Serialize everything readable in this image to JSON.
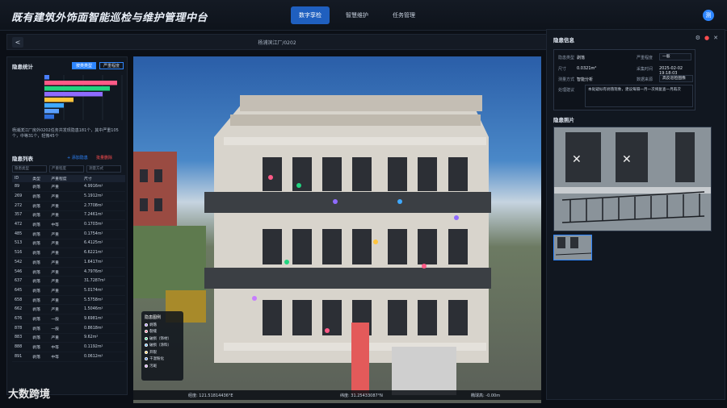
{
  "app": {
    "title": "既有建筑外饰面智能巡检与维护管理中台",
    "avatar": "测"
  },
  "nav": {
    "tabs": [
      {
        "label": "数字孪检",
        "active": true
      },
      {
        "label": "智慧维护",
        "active": false
      },
      {
        "label": "任务管理",
        "active": false
      }
    ]
  },
  "subbar": {
    "back": "<",
    "breadcrumb": "杨浦滨江厂/0202"
  },
  "stats": {
    "title": "隐患统计",
    "toggle_a": "按类类型",
    "toggle_b": "严重程度",
    "summary": "杨浦滨江厂房外0202任务共发现隐患181个，其中严重105个，中等31个，轻微45个"
  },
  "chart_data": {
    "type": "bar",
    "orientation": "horizontal",
    "categories": [
      "",
      "",
      "",
      "",
      "",
      "",
      "",
      ""
    ],
    "values": [
      2,
      30,
      27,
      24,
      12,
      8,
      6,
      4
    ],
    "colors": [
      "#4a7fff",
      "#ff5a87",
      "#21d47f",
      "#8f6bff",
      "#ffc53d",
      "#3fa9ff",
      "#5aa0ff",
      "#2e6edc"
    ],
    "xlim": [
      0,
      32
    ],
    "grid": true
  },
  "list": {
    "title": "隐患列表",
    "add": "+ 添加隐患",
    "delete": "批量删除",
    "filters": [
      "隐患类型",
      "严重程度",
      "测量方式"
    ],
    "headers": [
      "ID",
      "类型",
      "严重程度",
      "尺寸"
    ],
    "rows": [
      [
        "89",
        "剥落",
        "严重",
        "4.9916m²"
      ],
      [
        "269",
        "剥落",
        "严重",
        "5.1912m²"
      ],
      [
        "272",
        "剥落",
        "严重",
        "2.7708m²"
      ],
      [
        "357",
        "剥落",
        "严重",
        "7.2461m²"
      ],
      [
        "472",
        "剥落",
        "中等",
        "0.1703m²"
      ],
      [
        "485",
        "剥落",
        "严重",
        "0.1754m²"
      ],
      [
        "513",
        "剥落",
        "严重",
        "6.4125m²"
      ],
      [
        "516",
        "剥落",
        "严重",
        "6.6221m²"
      ],
      [
        "542",
        "剥落",
        "严重",
        "1.6417m²"
      ],
      [
        "546",
        "剥落",
        "严重",
        "4.7976m²"
      ],
      [
        "637",
        "剥落",
        "严重",
        "31.7287m²"
      ],
      [
        "645",
        "剥落",
        "严重",
        "5.0174m²"
      ],
      [
        "658",
        "剥落",
        "严重",
        "5.5758m²"
      ],
      [
        "662",
        "剥落",
        "严重",
        "1.5046m²"
      ],
      [
        "676",
        "剥落",
        "一般",
        "9.6981m²"
      ],
      [
        "878",
        "剥落",
        "一般",
        "0.8618m²"
      ],
      [
        "883",
        "剥落",
        "严重",
        "9.62m²"
      ],
      [
        "888",
        "剥落",
        "中等",
        "0.1192m²"
      ],
      [
        "891",
        "剥落",
        "中等",
        "0.0612m²"
      ]
    ]
  },
  "legend": {
    "title": "隐患图例",
    "items": [
      {
        "label": "剥落",
        "color": "#8f6bff"
      },
      {
        "label": "裂缝",
        "color": "#ff5a87"
      },
      {
        "label": "破损（饰材）",
        "color": "#21d47f"
      },
      {
        "label": "破损（涂料）",
        "color": "#3fa9ff"
      },
      {
        "label": "开裂",
        "color": "#ffc53d"
      },
      {
        "label": "干湿粉化",
        "color": "#2e6edc"
      },
      {
        "label": "污斑",
        "color": "#c77dff"
      }
    ]
  },
  "status": {
    "lon": "经度: 121.51814436°E",
    "lat": "纬度: 31.25433087°N",
    "alt": "椭球高: -0.00m"
  },
  "detail": {
    "title": "隐患信息",
    "labels": {
      "type": "隐患类型",
      "severity": "严重程度",
      "size": "尺寸",
      "time": "采集时间",
      "method": "测量方式",
      "source": "数据来源",
      "advice": "处理建议"
    },
    "values": {
      "type": "剥落",
      "severity": "一般",
      "size": "0.0321m²",
      "time": "2025-02-02 19:18:03",
      "method": "智能分析",
      "source": "高反巡检图像"
    },
    "advice": "本处疑似有剥落现象，建议每隔一月一次将复查一月再次",
    "photo_title": "隐患照片"
  },
  "watermark": "大数跨境"
}
